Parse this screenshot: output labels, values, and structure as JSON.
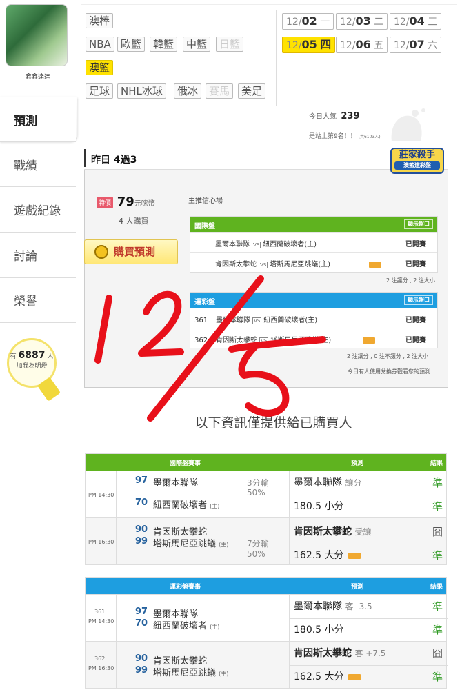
{
  "user": {
    "name": "鑫鑫達達"
  },
  "sidebar": {
    "items": [
      {
        "label": "預測"
      },
      {
        "label": "戰績"
      },
      {
        "label": "遊戲紀錄"
      },
      {
        "label": "討論"
      },
      {
        "label": "榮譽"
      }
    ]
  },
  "fans": {
    "prefix": "有",
    "count": "6887",
    "suffix": "人",
    "sub": "加我為明燈"
  },
  "leagues": [
    "澳棒",
    "NBA",
    "歐籃",
    "韓籃",
    "中籃",
    "日籃",
    "澳籃",
    "足球",
    "NHL冰球",
    "俄冰",
    "賽馬",
    "美足"
  ],
  "dates": [
    {
      "md": "12/",
      "d": "02",
      "w": "一"
    },
    {
      "md": "12/",
      "d": "03",
      "w": "二"
    },
    {
      "md": "12/",
      "d": "04",
      "w": "三"
    },
    {
      "md": "12/",
      "d": "05",
      "w": "四"
    },
    {
      "md": "12/",
      "d": "06",
      "w": "五"
    },
    {
      "md": "12/",
      "d": "07",
      "w": "六"
    }
  ],
  "popularity": {
    "label": "今日人氣",
    "value": "239",
    "rank": "是站上第9名！！",
    "total": "(共6103人)"
  },
  "yesterday": {
    "title": "昨日 4過3"
  },
  "badge": {
    "line1": "莊家殺手",
    "line2": "澳籃連彩盤"
  },
  "purchase": {
    "disc": "特價",
    "price": "79",
    "unit": "元嗦幣",
    "buyers": "4 人購買",
    "button": "購買預測",
    "mainpick": "主推信心場"
  },
  "intl_small": {
    "title": "國際盤",
    "show": "顯示盤口",
    "rows": [
      {
        "a": "墨爾本聯隊",
        "vs": "VS",
        "b": "紐西蘭破壞者(主)",
        "status": "已開賽"
      },
      {
        "a": "肯因斯太攀蛇",
        "vs": "VS",
        "b": "塔斯馬尼亞跳蟻(主)",
        "status": "已開賽"
      }
    ],
    "note": "2 注讓分 , 2 注大小"
  },
  "lottery_small": {
    "title": "運彩盤",
    "show": "顯示盤口",
    "rows": [
      {
        "no": "361",
        "a": "墨爾本聯隊",
        "vs": "VS",
        "b": "紐西蘭破壞者(主)",
        "status": "已開賽"
      },
      {
        "no": "362",
        "a": "肯因斯太攀蛇",
        "vs": "VS",
        "b": "塔斯馬尼亞跳蟻(主)",
        "status": "已開賽"
      }
    ],
    "note": "2 注讓分 , 0 注不讓分 , 2 注大小",
    "note2": "今日有人使用兌換券觀看您的預測"
  },
  "handwriting": "12/5",
  "info_title": "以下資訊僅提供給已購買人",
  "intl_table": {
    "h1": "國際盤賽事",
    "h2": "預測",
    "h3": "結果",
    "games": [
      {
        "time": "PM 14:30",
        "s1": "97",
        "t1": "墨爾本聯隊",
        "s2": "70",
        "t2": "紐西蘭破壞者",
        "home": "(主)",
        "spread": "3分輸",
        "pct": "50%",
        "p1": "墨爾本聯隊",
        "p1x": "讓分",
        "r1": "準",
        "p2": "180.5 小分",
        "r2": "準"
      },
      {
        "time": "PM 16:30",
        "s1": "90",
        "t1": "肯因斯太攀蛇",
        "s2": "99",
        "t2": "塔斯馬尼亞跳蟻",
        "home": "(主)",
        "spread": "7分輸",
        "pct": "50%",
        "p1": "肯因斯太攀蛇",
        "p1x": "受讓",
        "r1": "囧",
        "p2": "162.5 大分",
        "r2": "準"
      }
    ]
  },
  "lottery_table": {
    "h1": "運彩盤賽事",
    "h2": "預測",
    "h3": "結果",
    "games": [
      {
        "no": "361",
        "time": "PM 14:30",
        "s1": "97",
        "t1": "墨爾本聯隊",
        "s2": "70",
        "t2": "紐西蘭破壞者",
        "home": "(主)",
        "p1": "墨爾本聯隊",
        "p1x": "客 -3.5",
        "r1": "準",
        "p2": "180.5 小分",
        "r2": "準"
      },
      {
        "no": "362",
        "time": "PM 16:30",
        "s1": "90",
        "t1": "肯因斯太攀蛇",
        "s2": "99",
        "t2": "塔斯馬尼亞跳蟻",
        "home": "(主)",
        "p1": "肯因斯太攀蛇",
        "p1x": "客 +7.5",
        "r1": "囧",
        "p2": "162.5 大分",
        "r2": "準"
      }
    ]
  },
  "colors": {
    "green": "#5fb31f",
    "blue": "#1e9ee0",
    "yellow": "#ffe200",
    "handwriting": "#e8101a"
  }
}
